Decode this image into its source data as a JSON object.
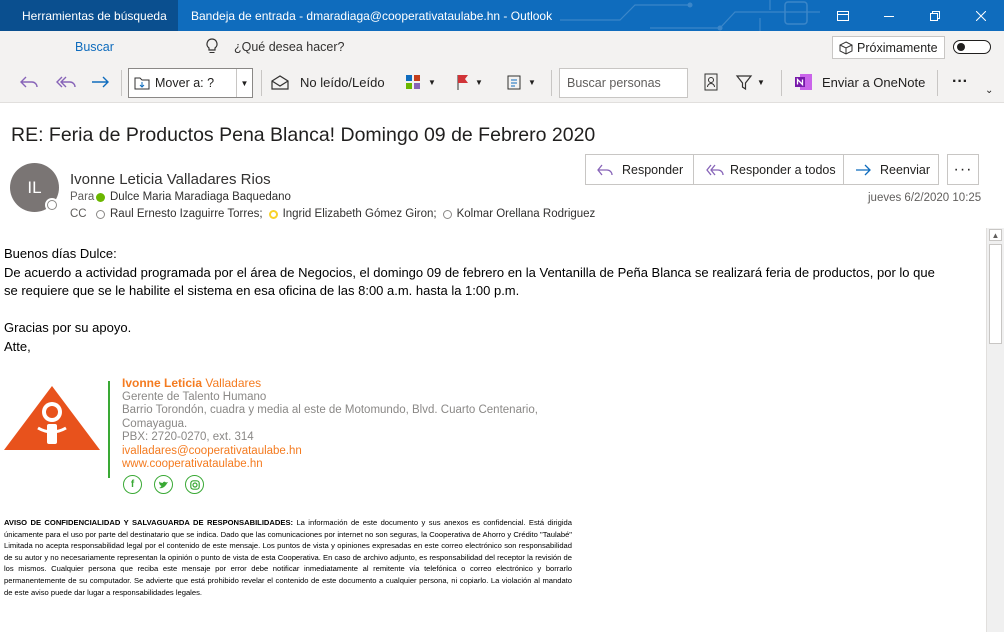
{
  "window": {
    "tools_tab": "Herramientas de búsqueda",
    "title": "Bandeja de entrada - dmaradiaga@cooperativataulabe.hn  -  Outlook"
  },
  "tellme": {
    "search_tab": "Buscar",
    "prompt": "¿Qué desea hacer?",
    "coming_soon": "Próximamente"
  },
  "ribbon": {
    "move_label": "Mover a: ?",
    "read_label": "No leído/Leído",
    "people_search_placeholder": "Buscar personas",
    "onenote_label": "Enviar a OneNote"
  },
  "message": {
    "subject": "RE: Feria de Productos Pena Blanca! Domingo 09 de Febrero 2020",
    "avatar_initials": "IL",
    "sender": "Ivonne Leticia Valladares Rios",
    "to_label": "Para",
    "to": "Dulce Maria Maradiaga Baquedano",
    "cc_label": "CC",
    "cc": [
      "Raul Ernesto Izaguirre Torres;",
      "Ingrid Elizabeth Gómez Giron;",
      "Kolmar Orellana Rodriguez"
    ],
    "datetime": "jueves 6/2/2020 10:25",
    "actions": {
      "reply": "Responder",
      "reply_all": "Responder a todos",
      "forward": "Reenviar",
      "more": "···"
    },
    "body": {
      "greeting": "Buenos días Dulce:",
      "line1": "De acuerdo a actividad programada por el área de Negocios, el domingo 09 de febrero en la Ventanilla de Peña Blanca se realizará feria de productos, por lo que",
      "line2": "se requiere que se le habilite el sistema en esa oficina de las 8:00 a.m. hasta la 1:00 p.m.",
      "thanks": "Gracias por su apoyo.",
      "closing": "Atte,"
    },
    "signature": {
      "name_first": "Ivonne Leticia",
      "name_last": "Valladares",
      "role": "Gerente de Talento Humano",
      "address1": "Barrio Torondón, cuadra y media al este de Motomundo, Blvd. Cuarto Centenario,",
      "address2": "Comayagua.",
      "phone": "PBX: 2720-0270, ext. 314",
      "email": "ivalladares@cooperativataulabe.hn",
      "web": "www.cooperativataulabe.hn"
    },
    "disclaimer": {
      "title": "AVISO DE CONFIDENCIALIDAD  Y SALVAGUARDA DE RESPONSABILIDADES:",
      "text": "La información de este documento y sus anexos es confidencial. Está dirigida únicamente para el uso por parte del destinatario que se indica. Dado que las comunicaciones por internet no son seguras, la Cooperativa de Ahorro y Crédito \"Taulabé\" Limitada no acepta responsabilidad legal por el contenido de este mensaje. Los puntos de vista y opiniones expresadas en este correo electrónico son responsabilidad de su autor y no necesariamente representan la opinión o punto de vista de esta Cooperativa. En caso de archivo adjunto, es responsabilidad del receptor la revisión de los mismos. Cualquier persona que reciba este mensaje por error debe notificar inmediatamente al remitente vía telefónica o correo electrónico y borrarlo permanentemente de su computador. Se advierte que está prohibido revelar el contenido de este documento a cualquier persona, ni copiarlo. La violación al mandato de este aviso puede dar lugar a responsabilidades legales."
    }
  },
  "colors": {
    "titlebar": "#0f6cbd",
    "accent_orange": "#f47b20",
    "accent_green": "#3aa935"
  }
}
